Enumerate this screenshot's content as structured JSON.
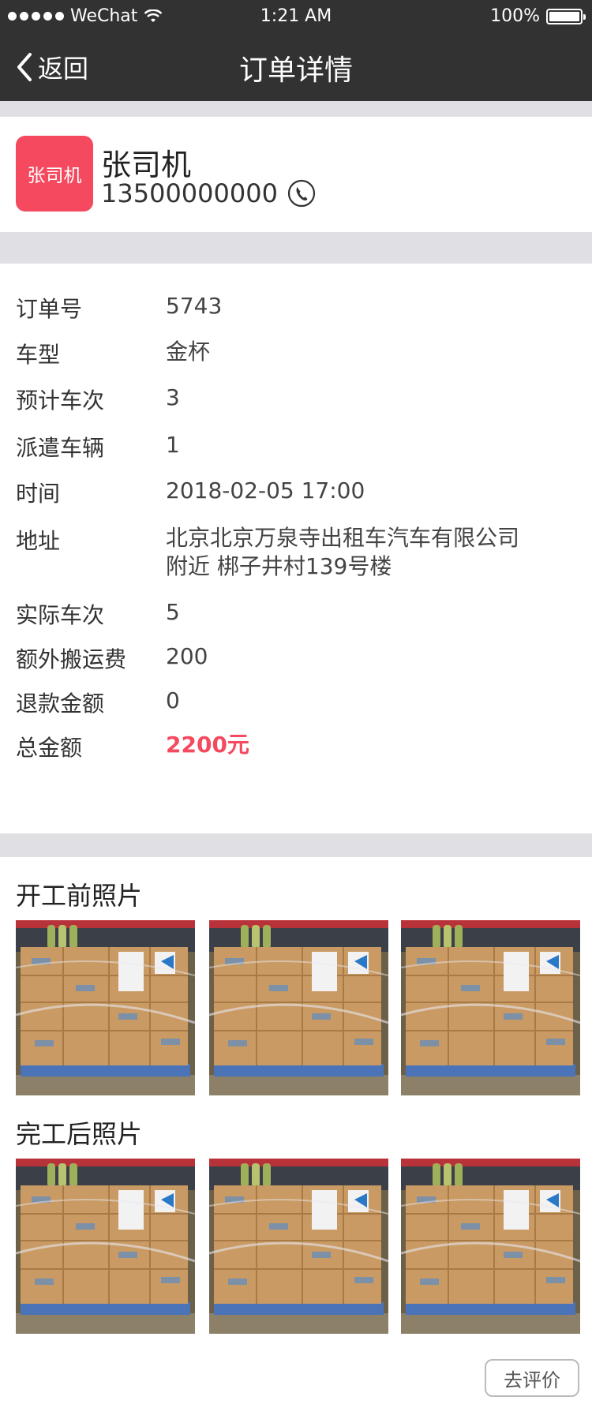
{
  "status_bar": {
    "carrier": "WeChat",
    "time": "1:21 AM",
    "battery": "100%"
  },
  "nav": {
    "back_label": "返回",
    "title": "订单详情"
  },
  "driver": {
    "avatar_text": "张司机",
    "name": "张司机",
    "phone": "13500000000"
  },
  "order": {
    "rows": [
      {
        "label": "订单号",
        "value": "5743"
      },
      {
        "label": "车型",
        "value": "金杯"
      },
      {
        "label": "预计车次",
        "value": "3"
      },
      {
        "label": "派遣车辆",
        "value": "1"
      },
      {
        "label": "时间",
        "value": "2018-02-05 17:00"
      },
      {
        "label": "地址",
        "value": "北京北京万泉寺出租车汽车有限公司",
        "value2": "附近 梆子井村139号楼"
      },
      {
        "label": "实际车次",
        "value": "5"
      },
      {
        "label": "额外搬运费",
        "value": "200"
      },
      {
        "label": "退款金额",
        "value": "0"
      },
      {
        "label": "总金额",
        "value": "2200元"
      }
    ],
    "total_color": "#f4495e"
  },
  "photos": {
    "before_title": "开工前照片",
    "after_title": "完工后照片"
  },
  "actions": {
    "review_label": "去评价"
  },
  "colors": {
    "header_bg": "#323232",
    "accent": "#f4495e",
    "separator": "#e0e0e4"
  }
}
